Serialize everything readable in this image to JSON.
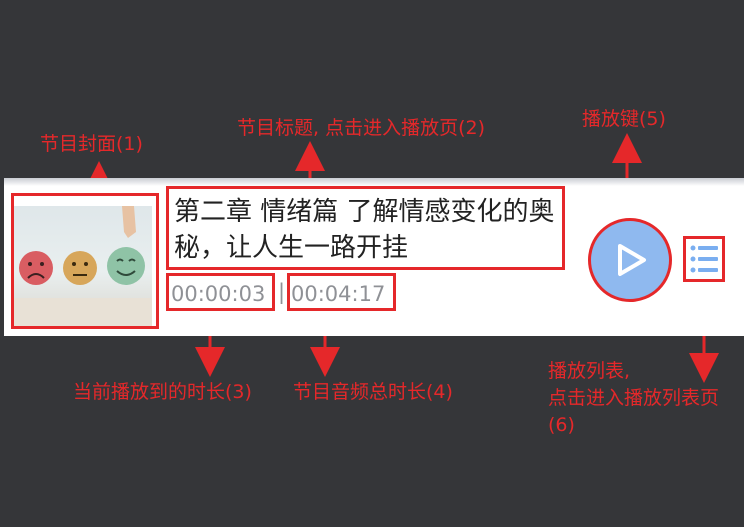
{
  "annotations": {
    "cover": "节目封面(1)",
    "title": "节目标题, 点击进入播放页(2)",
    "play": "播放键(5)",
    "current_time": "当前播放到的时长(3)",
    "total_time": "节目音频总时长(4)",
    "playlist_line1": "播放列表,",
    "playlist_line2": "点击进入播放列表页",
    "playlist_line3": "(6)"
  },
  "episode": {
    "title": "第二章 情绪篇 了解情感变化的奥秘，让人生一路开挂",
    "current_time": "00:00:03",
    "separator": "|",
    "total_time": "00:04:17"
  },
  "icons": {
    "play": "play-icon",
    "playlist": "playlist-icon",
    "cover_faces": [
      "sad-face",
      "neutral-face",
      "happy-face"
    ]
  },
  "colors": {
    "annotation": "#e5282a",
    "play_button": "#8fb9ef",
    "playlist_icon": "#7aaef0",
    "time_text": "#8f9196",
    "background": "#353639"
  }
}
